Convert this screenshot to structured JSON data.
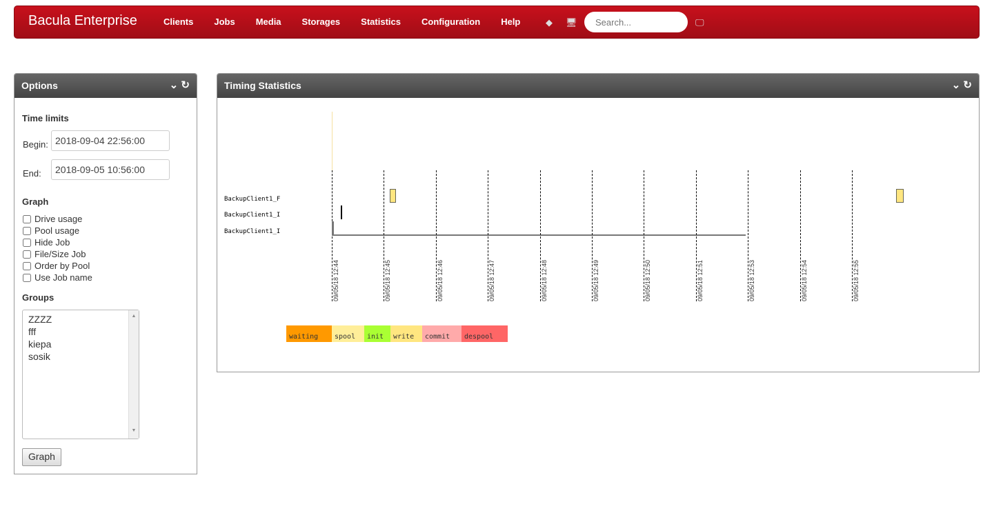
{
  "nav": {
    "brand": "Bacula Enterprise",
    "items": [
      "Clients",
      "Jobs",
      "Media",
      "Storages",
      "Statistics",
      "Configuration",
      "Help"
    ],
    "search_placeholder": "Search..."
  },
  "options": {
    "title": "Options",
    "time_limits": "Time limits",
    "begin_label": "Begin:",
    "begin_value": "2018-09-04 22:56:00",
    "end_label": "End:",
    "end_value": "2018-09-05 10:56:00",
    "graph_label": "Graph",
    "checkboxes": [
      "Drive usage",
      "Pool usage",
      "Hide Job",
      "File/Size Job",
      "Order by Pool",
      "Use Job name"
    ],
    "groups_label": "Groups",
    "groups": [
      "ZZZZ",
      "fff",
      "kiepa",
      "sosik"
    ],
    "graph_button": "Graph"
  },
  "timing": {
    "title": "Timing Statistics"
  },
  "chart_data": {
    "type": "gantt",
    "rows": [
      "BackupClient1_F",
      "BackupClient1_I",
      "BackupClient1_I"
    ],
    "ticks": [
      "09/05/18 12:44",
      "09/05/18 12:45",
      "09/05/18 12:46",
      "09/05/18 12:47",
      "09/05/18 12:48",
      "09/05/18 12:49",
      "09/05/18 12:50",
      "09/05/18 12:51",
      "09/05/18 12:53",
      "09/05/18 12:54",
      "09/05/18 12:55"
    ],
    "jobs": [
      {
        "row": 0,
        "start": "12:45:07",
        "end": "12:45:14",
        "phase": "write",
        "color": "#ffe680"
      },
      {
        "row": 0,
        "start": "12:54:51",
        "end": "12:55:00",
        "phase": "write",
        "color": "#ffe680"
      },
      {
        "row": 1,
        "start": "12:44:10",
        "end": "12:44:11",
        "phase": "",
        "color": "#000000"
      },
      {
        "row": 2,
        "start": "12:44:00",
        "end": "12:44:02",
        "phase": "",
        "color": "#777777"
      }
    ],
    "legend": [
      {
        "label": "waiting",
        "color": "#ff9900"
      },
      {
        "label": "spool",
        "color": "#ffee99"
      },
      {
        "label": "init",
        "color": "#aaff33"
      },
      {
        "label": "write",
        "color": "#ffe680"
      },
      {
        "label": "commit",
        "color": "#ffaaaa"
      },
      {
        "label": "despool",
        "color": "#ff6666"
      }
    ]
  }
}
